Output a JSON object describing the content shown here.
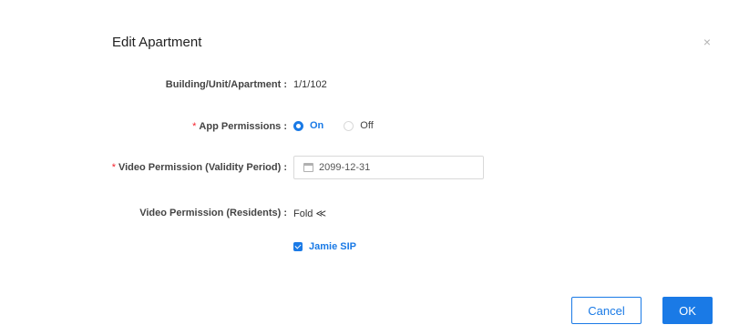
{
  "dialog": {
    "title": "Edit Apartment",
    "close_glyph": "×"
  },
  "form": {
    "building": {
      "label": "Building/Unit/Apartment :",
      "value": "1/1/102"
    },
    "app_permissions": {
      "required_mark": "*",
      "label": "App Permissions :",
      "options": [
        "On",
        "Off"
      ],
      "selected": "On"
    },
    "video_validity": {
      "required_mark": "*",
      "label": "Video Permission (Validity Period) :",
      "value": "2099-12-31",
      "icon": "calendar-icon"
    },
    "video_residents": {
      "label": "Video Permission (Residents) :",
      "toggle_text": "Fold ≪",
      "residents": [
        {
          "name": "Jamie SIP",
          "checked": true
        }
      ]
    }
  },
  "footer": {
    "cancel_label": "Cancel",
    "ok_label": "OK"
  },
  "colors": {
    "accent": "#1a7ae6",
    "required": "#f5222d"
  }
}
